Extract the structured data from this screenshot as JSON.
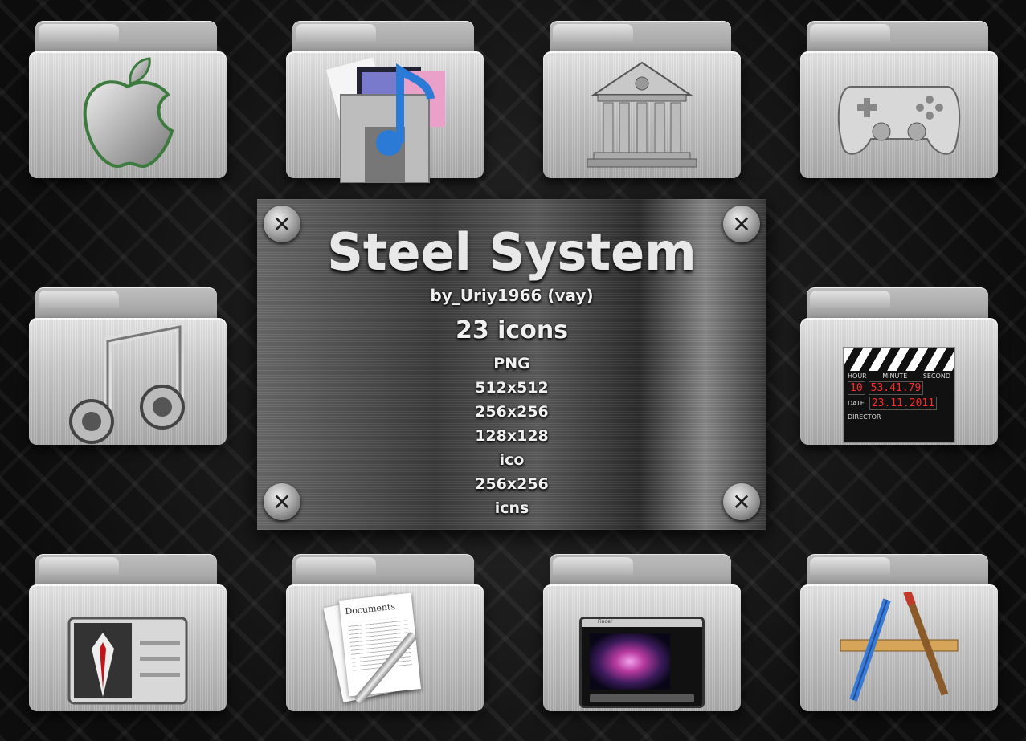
{
  "plate": {
    "title": "Steel System",
    "author": "by_Uriy1966 (vay)",
    "count": "23 icons",
    "specs": [
      "PNG",
      "512x512",
      "256x256",
      "128x128",
      "ico",
      "256x256",
      "icns"
    ]
  },
  "folders": [
    {
      "name": "apple-folder",
      "icon": "apple-icon"
    },
    {
      "name": "media-folder",
      "icon": "media-icon"
    },
    {
      "name": "library-folder",
      "icon": "bank-icon"
    },
    {
      "name": "games-folder",
      "icon": "gamepad-icon"
    },
    {
      "name": "music-folder",
      "icon": "music-note-icon"
    },
    {
      "name": "movies-folder",
      "icon": "clapperboard-icon"
    },
    {
      "name": "users-folder",
      "icon": "user-card-icon"
    },
    {
      "name": "documents-folder",
      "icon": "documents-icon"
    },
    {
      "name": "desktop-folder",
      "icon": "desktop-icon"
    },
    {
      "name": "applications-folder",
      "icon": "applications-icon"
    }
  ],
  "clapper": {
    "hour_label": "HOUR",
    "minute_label": "MINUTE",
    "second_label": "SECOND",
    "hour": "10",
    "time": "53.41.79",
    "date_label": "DATE",
    "date": "23.11.2011",
    "director_label": "DIRECTOR"
  },
  "documents_label": "Documents",
  "desktop_label": "Finder"
}
